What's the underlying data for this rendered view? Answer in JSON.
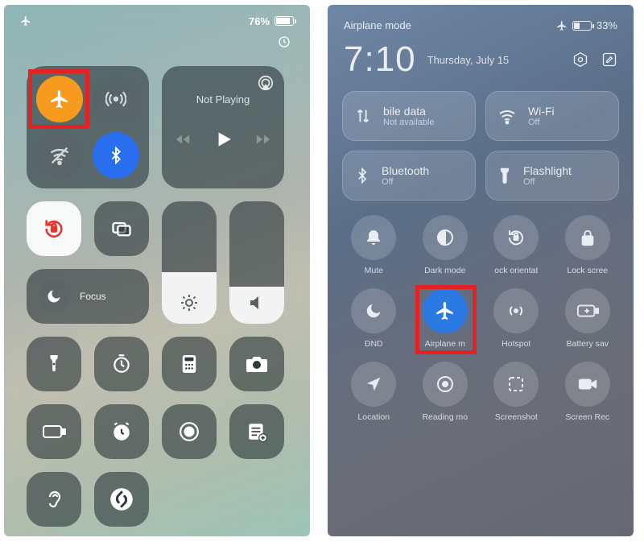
{
  "ios": {
    "status": {
      "battery_pct": "76%",
      "battery_fill": 76
    },
    "media": {
      "label": "Not Playing"
    },
    "focus_label": "Focus",
    "highlight": "airplane"
  },
  "android": {
    "status": {
      "mode": "Airplane mode",
      "battery_pct": "33%",
      "battery_fill": 33
    },
    "clock": "7:10",
    "date": "Thursday, July 15",
    "tiles": {
      "mobile": {
        "title": "bile data",
        "sub": "Not available"
      },
      "wifi": {
        "title": "Wi-Fi",
        "sub": "Off"
      },
      "bt": {
        "title": "Bluetooth",
        "sub": "Off"
      },
      "flash": {
        "title": "Flashlight",
        "sub": "Off"
      }
    },
    "round": [
      {
        "key": "mute",
        "label": "Mute"
      },
      {
        "key": "dark",
        "label": "Dark mode"
      },
      {
        "key": "rot",
        "label": "ock orientat"
      },
      {
        "key": "lock",
        "label": "Lock scree"
      },
      {
        "key": "dnd",
        "label": "DND"
      },
      {
        "key": "air",
        "label": "Airplane m",
        "on": true,
        "highlight": true
      },
      {
        "key": "hotspot",
        "label": "Hotspot"
      },
      {
        "key": "batt",
        "label": "Battery sav"
      },
      {
        "key": "loc",
        "label": "Location"
      },
      {
        "key": "read",
        "label": "Reading mo"
      },
      {
        "key": "shot",
        "label": "Screenshot"
      },
      {
        "key": "rec",
        "label": "Screen Rec"
      }
    ]
  }
}
